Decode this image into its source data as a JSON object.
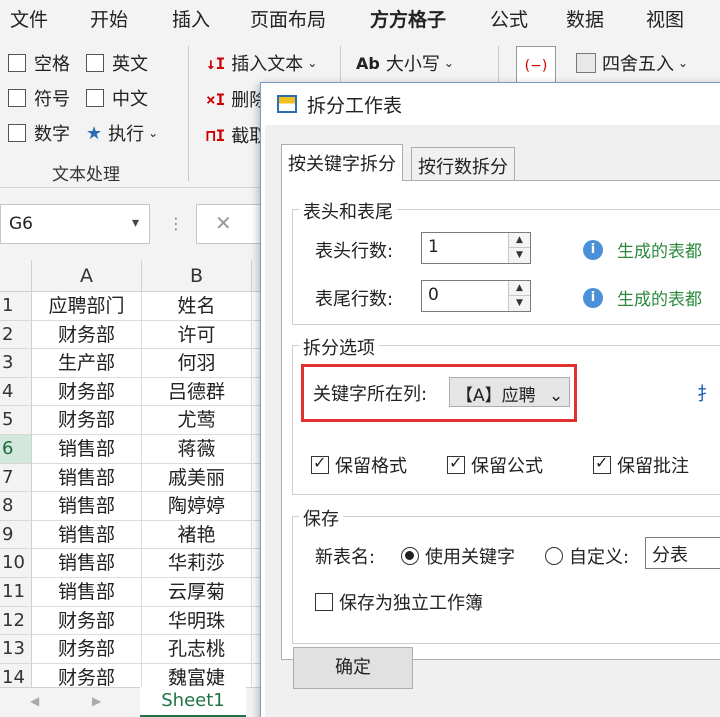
{
  "menu": {
    "items": [
      "文件",
      "开始",
      "插入",
      "页面布局",
      "方方格子",
      "公式",
      "数据",
      "视图"
    ],
    "active": "方方格子"
  },
  "ribbon": {
    "text_group": {
      "options": [
        "空格",
        "英文",
        "符号",
        "中文",
        "数字"
      ],
      "execute_label": "执行",
      "group_label": "文本处理"
    },
    "insert_text_label": "插入文本",
    "delete_label": "删除",
    "trim_label": "截取",
    "case_label": "大小写",
    "case_icon": "Ab",
    "round_label": "四舍五入"
  },
  "formula_bar": {
    "name_box": "G6"
  },
  "grid": {
    "col_a": "A",
    "col_b": "B",
    "rows": [
      {
        "n": "1",
        "a": "应聘部门",
        "b": "姓名"
      },
      {
        "n": "2",
        "a": "财务部",
        "b": "许可"
      },
      {
        "n": "3",
        "a": "生产部",
        "b": "何羽"
      },
      {
        "n": "4",
        "a": "财务部",
        "b": "吕德群"
      },
      {
        "n": "5",
        "a": "财务部",
        "b": "尤莺"
      },
      {
        "n": "6",
        "a": "销售部",
        "b": "蒋薇"
      },
      {
        "n": "7",
        "a": "销售部",
        "b": "戚美丽"
      },
      {
        "n": "8",
        "a": "销售部",
        "b": "陶婷婷"
      },
      {
        "n": "9",
        "a": "销售部",
        "b": "褚艳"
      },
      {
        "n": "10",
        "a": "销售部",
        "b": "华莉莎"
      },
      {
        "n": "11",
        "a": "销售部",
        "b": "云厚菊"
      },
      {
        "n": "12",
        "a": "财务部",
        "b": "华明珠"
      },
      {
        "n": "13",
        "a": "财务部",
        "b": "孔志桃"
      },
      {
        "n": "14",
        "a": "财务部",
        "b": "魏富婕"
      }
    ],
    "selected_row": "6",
    "sheet_tab": "Sheet1"
  },
  "dialog": {
    "title": "拆分工作表",
    "tabs": [
      "按关键字拆分",
      "按行数拆分"
    ],
    "header_footer": {
      "legend": "表头和表尾",
      "header_rows_label": "表头行数:",
      "header_rows_value": "1",
      "footer_rows_label": "表尾行数:",
      "footer_rows_value": "0",
      "header_hint": "生成的表都",
      "footer_hint": "生成的表都"
    },
    "split_options": {
      "legend": "拆分选项",
      "key_column_label": "关键字所在列:",
      "key_column_value": "【A】应聘",
      "keep_format": "保留格式",
      "keep_formula": "保留公式",
      "keep_comment": "保留批注",
      "link_fragment": "扌"
    },
    "save": {
      "legend": "保存",
      "new_name_label": "新表名:",
      "use_keyword": "使用关键字",
      "custom": "自定义:",
      "custom_value": "分表",
      "separate_workbook": "保存为独立工作簿"
    },
    "ok_button": "确定"
  }
}
